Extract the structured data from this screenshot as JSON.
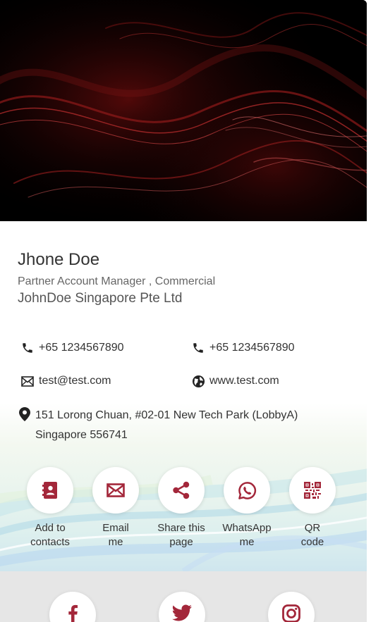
{
  "colors": {
    "accent": "#a3273a",
    "text": "#333333",
    "muted": "#666666",
    "footer": "#e6e6e6"
  },
  "profile": {
    "name": "Jhone Doe",
    "title": "Partner Account Manager , Commercial",
    "company": "JohnDoe Singapore Pte Ltd"
  },
  "contacts": {
    "phone1": {
      "icon": "phone-icon",
      "value": "+65 1234567890"
    },
    "phone2": {
      "icon": "phone-icon",
      "value": "+65 1234567890"
    },
    "email": {
      "icon": "envelope-icon",
      "value": "test@test.com"
    },
    "website": {
      "icon": "globe-icon",
      "value": "www.test.com"
    },
    "address": {
      "icon": "map-pin-icon",
      "line1": "151 Lorong Chuan, #02-01 New Tech Park (LobbyA)",
      "line2": "Singapore 556741"
    }
  },
  "actions": [
    {
      "icon": "address-book-icon",
      "line1": "Add to",
      "line2": "contacts"
    },
    {
      "icon": "envelope-icon",
      "line1": "Email",
      "line2": "me"
    },
    {
      "icon": "share-icon",
      "line1": "Share this",
      "line2": "page"
    },
    {
      "icon": "whatsapp-icon",
      "line1": "WhatsApp",
      "line2": "me"
    },
    {
      "icon": "qr-code-icon",
      "line1": "QR",
      "line2": "code"
    }
  ],
  "social": [
    {
      "icon": "facebook-icon"
    },
    {
      "icon": "twitter-icon"
    },
    {
      "icon": "instagram-icon"
    }
  ]
}
